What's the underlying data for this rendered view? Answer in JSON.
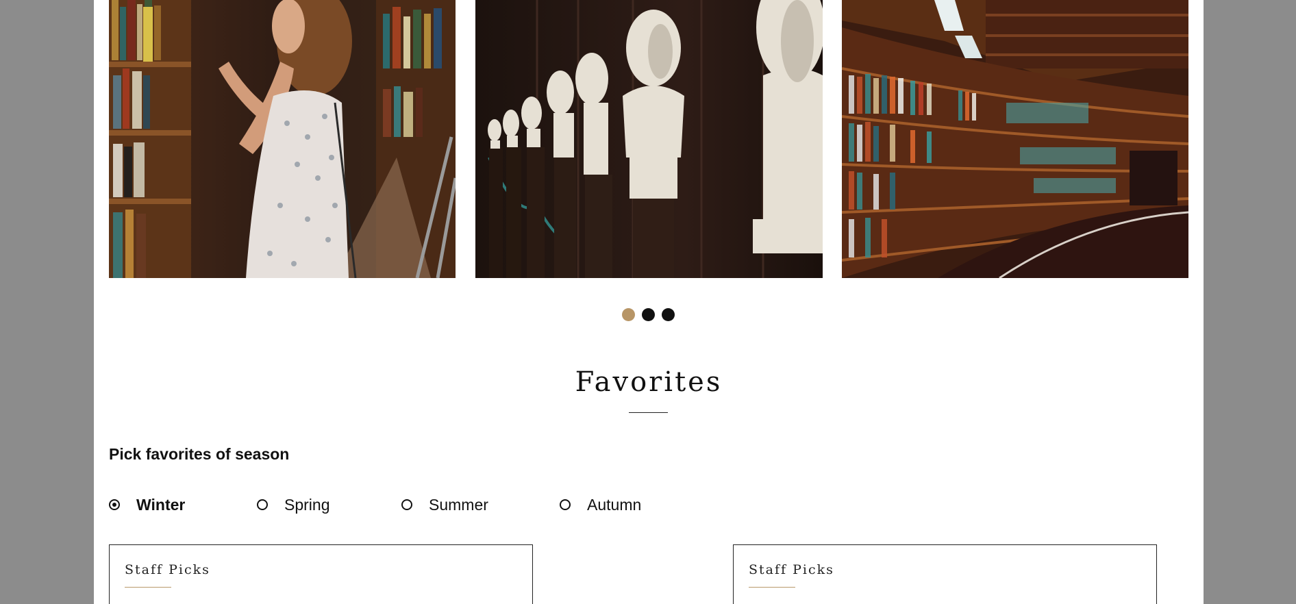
{
  "gallery": {
    "images": [
      {
        "alt": "woman browsing library shelves"
      },
      {
        "alt": "row of marble busts in library"
      },
      {
        "alt": "curved library bookshelves"
      }
    ],
    "pagination": {
      "active_index": 0,
      "count": 3,
      "active_color": "#b79566",
      "inactive_color": "#111111"
    }
  },
  "favorites": {
    "title": "Favorites",
    "subtitle": "Pick favorites of season",
    "seasons": [
      {
        "label": "Winter",
        "selected": true
      },
      {
        "label": "Spring",
        "selected": false
      },
      {
        "label": "Summer",
        "selected": false
      },
      {
        "label": "Autumn",
        "selected": false
      }
    ],
    "cards": [
      {
        "title": "Staff Picks"
      },
      {
        "title": "Staff Picks"
      }
    ]
  },
  "colors": {
    "backdrop": "#8c8c8c",
    "page": "#ffffff",
    "accent": "#b79566",
    "text": "#111111"
  }
}
